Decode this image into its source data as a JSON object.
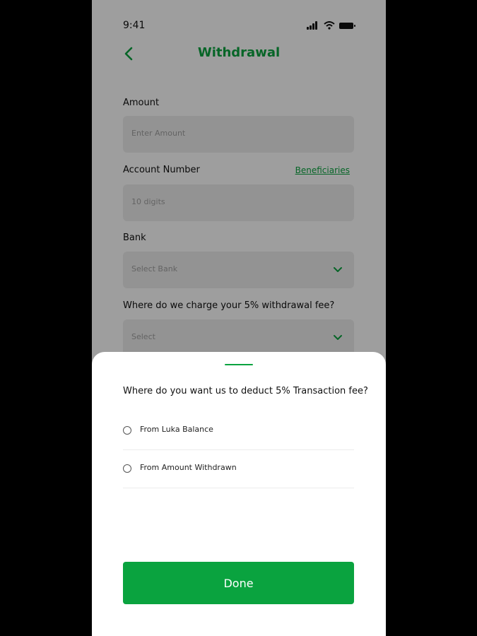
{
  "status_bar": {
    "time": "9:41"
  },
  "header": {
    "title": "Withdrawal"
  },
  "form": {
    "amount": {
      "label": "Amount",
      "placeholder": "Enter Amount"
    },
    "account_number": {
      "label": "Account Number",
      "placeholder": "10 digits",
      "link": "Beneficiaries"
    },
    "bank": {
      "label": "Bank",
      "placeholder": "Select Bank"
    },
    "fee_source": {
      "label": "Where do we charge your 5% withdrawal fee?",
      "placeholder": "Select"
    }
  },
  "sheet": {
    "question": "Where do you want us to deduct 5% Transaction fee?",
    "options": [
      {
        "label": "From Luka Balance",
        "selected": false
      },
      {
        "label": "From Amount Withdrawn",
        "selected": false
      }
    ],
    "done_label": "Done"
  },
  "colors": {
    "accent": "#0aa33f",
    "field_bg": "#eeeeee"
  }
}
